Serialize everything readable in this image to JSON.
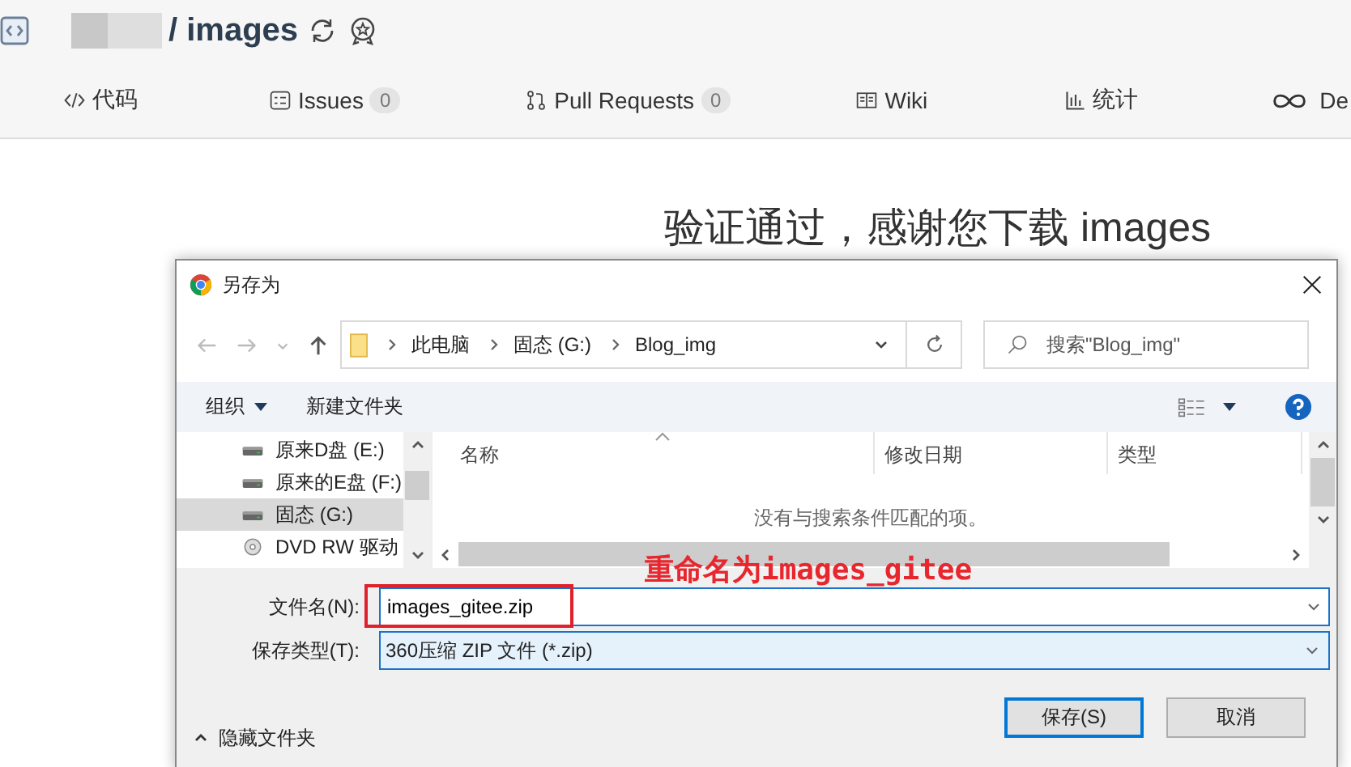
{
  "repo_header": {
    "title": "/ images"
  },
  "tabs": [
    {
      "label": "代码"
    },
    {
      "label": "Issues",
      "count": "0"
    },
    {
      "label": "Pull Requests",
      "count": "0"
    },
    {
      "label": "Wiki"
    },
    {
      "label": "统计"
    },
    {
      "label": "De"
    }
  ],
  "heading": "验证通过，感谢您下载 images",
  "dialog": {
    "title": "另存为",
    "breadcrumb": [
      "此电脑",
      "固态 (G:)",
      "Blog_img"
    ],
    "search": {
      "placeholder": "搜索\"Blog_img\""
    },
    "organize": "组织",
    "new_folder": "新建文件夹",
    "nav_items": [
      {
        "label": "原来D盘 (E:)",
        "kind": "drive",
        "selected": false
      },
      {
        "label": "原来的E盘 (F:)",
        "kind": "drive",
        "selected": false
      },
      {
        "label": "固态 (G:)",
        "kind": "drive",
        "selected": true
      },
      {
        "label": "DVD RW 驱动",
        "kind": "disc",
        "selected": false
      }
    ],
    "columns": [
      "名称",
      "修改日期",
      "类型"
    ],
    "empty_message": "没有与搜索条件匹配的项。",
    "filename": {
      "label": "文件名(N):",
      "value": "images_gitee.zip"
    },
    "filetype": {
      "label": "保存类型(T):",
      "value": "360压缩 ZIP 文件 (*.zip)"
    },
    "hide_folders": "隐藏文件夹",
    "buttons": [
      {
        "label": "保存(S)",
        "primary": true
      },
      {
        "label": "取消",
        "primary": false
      }
    ]
  },
  "annotation": {
    "text": "重命名为images_gitee"
  }
}
